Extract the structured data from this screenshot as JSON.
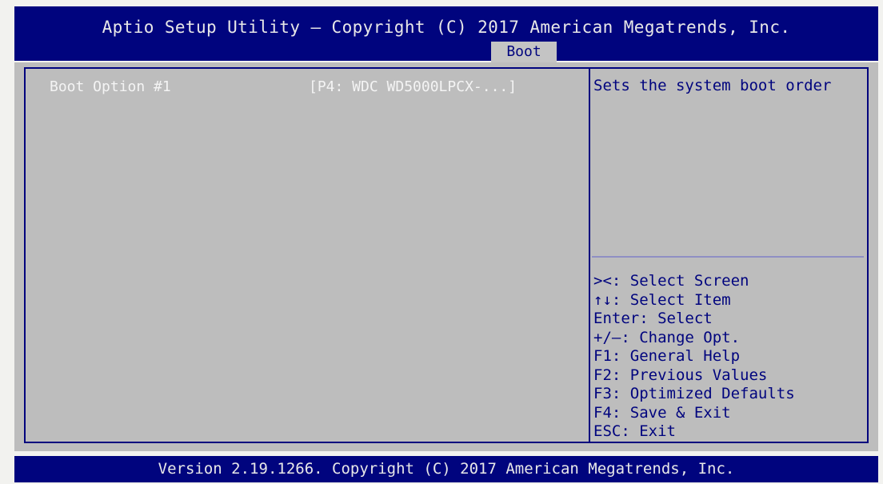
{
  "header": {
    "title": "Aptio Setup Utility – Copyright (C) 2017 American Megatrends, Inc.",
    "active_tab": "Boot"
  },
  "boot_options": {
    "label": "Boot Option #1",
    "value": "[P4: WDC WD5000LPCX-...]"
  },
  "help": {
    "description": "Sets the system boot order",
    "hints": [
      "><: Select Screen",
      "↑↓: Select Item",
      "Enter: Select",
      "+/–: Change Opt.",
      "F1: General Help",
      "F2: Previous Values",
      "F3: Optimized Defaults",
      "F4: Save & Exit",
      "ESC: Exit"
    ]
  },
  "footer": {
    "text": "Version 2.19.1266. Copyright (C) 2017 American Megatrends, Inc."
  },
  "colors": {
    "header_bg": "#00047e",
    "panel_bg": "#bdbdbd",
    "help_text": "#00047e",
    "item_text": "#f4f4f4"
  }
}
